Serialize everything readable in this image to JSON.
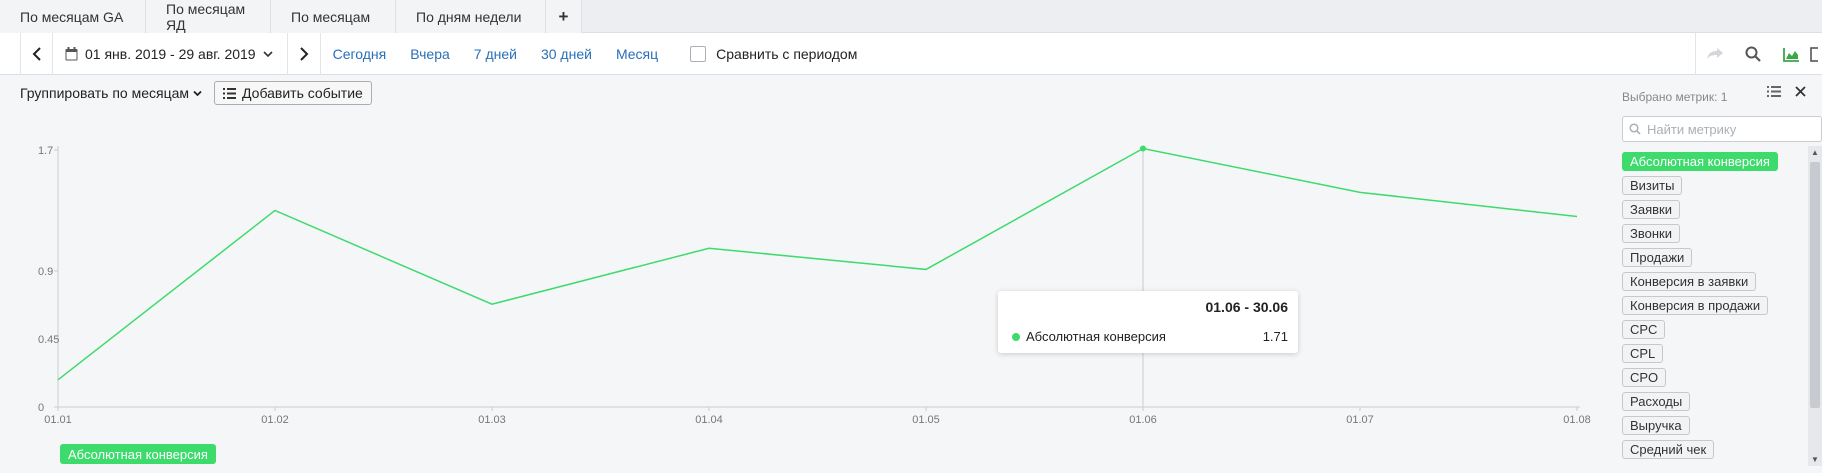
{
  "tabs": [
    "По месяцам GA",
    "По месяцам ЯД",
    "По месяцам",
    "По дням недели",
    "+"
  ],
  "toolbar": {
    "date_range": "01 янв. 2019 - 29 авг. 2019",
    "quick_periods": [
      "Сегодня",
      "Вчера",
      "7 дней",
      "30 дней",
      "Месяц"
    ],
    "compare_label": "Сравнить с периодом"
  },
  "group": {
    "select_value": "Группировать по месяцам",
    "add_event_label": "Добавить событие"
  },
  "chart_data": {
    "type": "line",
    "x": [
      "01.01",
      "01.02",
      "01.03",
      "01.04",
      "01.05",
      "01.06",
      "01.07",
      "01.08"
    ],
    "series": [
      {
        "name": "Абсолютная конверсия",
        "values": [
          0.18,
          1.3,
          0.68,
          1.05,
          0.91,
          1.71,
          1.42,
          1.26
        ],
        "color": "#3ddb6c"
      }
    ],
    "y_ticks": [
      "0",
      "0.45",
      "0.9",
      "1.7"
    ],
    "ylim": [
      0,
      1.7
    ],
    "grid": false,
    "legend_position": "bottom-left"
  },
  "tooltip": {
    "title": "01.06 - 30.06",
    "series_name": "Абсолютная конверсия",
    "value": "1.71"
  },
  "metrics_panel": {
    "selected_label": "Выбрано метрик: 1",
    "search_placeholder": "Найти метрику",
    "metrics": [
      "Абсолютная конверсия",
      "Визиты",
      "Заявки",
      "Звонки",
      "Продажи",
      "Конверсия в заявки",
      "Конверсия в продажи",
      "CPC",
      "CPL",
      "CPO",
      "Расходы",
      "Выручка",
      "Средний чек"
    ],
    "active_index": 0
  },
  "colors": {
    "accent": "#3ddb6c",
    "link": "#2a6fb8"
  }
}
